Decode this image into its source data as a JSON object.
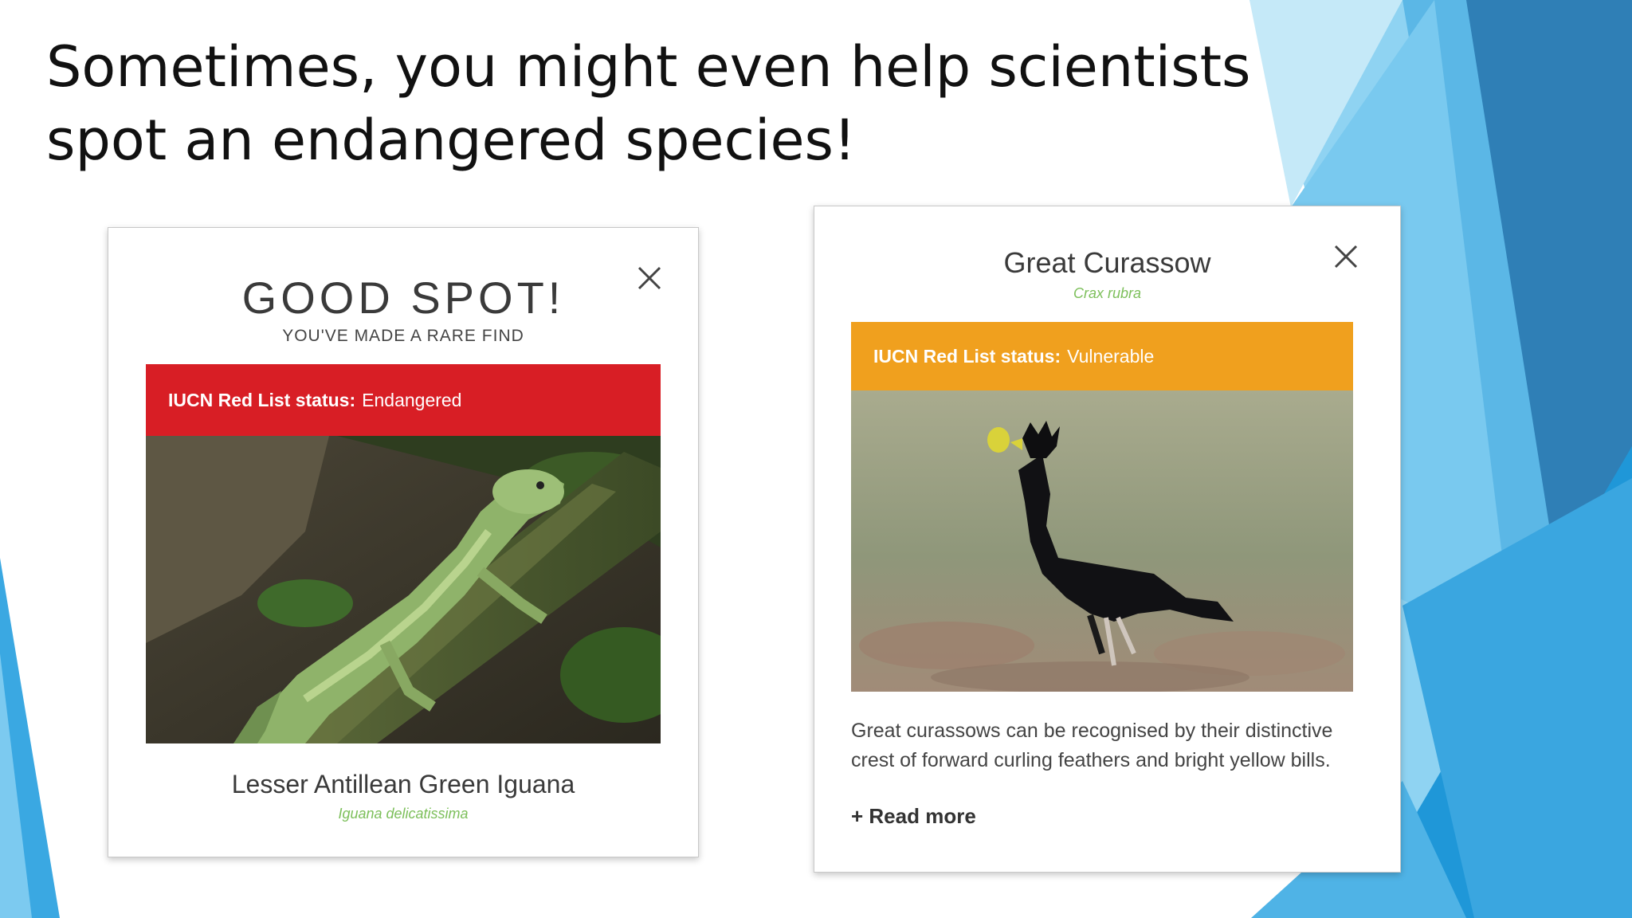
{
  "slide": {
    "title": "Sometimes, you might even help scientists spot an endangered species!"
  },
  "colors": {
    "endangered_red": "#d81e25",
    "vulnerable_orange": "#f0a01e",
    "scientific_name_green": "#7cbf5a",
    "accent_blue": "#2f9fd8"
  },
  "cards": [
    {
      "heading": "GOOD SPOT!",
      "subheading": "YOU'VE MADE A RARE FIND",
      "status_label": "IUCN Red List status:",
      "status_value": "Endangered",
      "photo_subject": "green iguana on a mossy branch",
      "common_name": "Lesser Antillean Green Iguana",
      "scientific_name": "Iguana delicatissima",
      "close_icon": "close-icon"
    },
    {
      "common_name": "Great Curassow",
      "scientific_name": "Crax rubra",
      "status_label": "IUCN Red List status:",
      "status_value": "Vulnerable",
      "photo_subject": "black curassow bird standing on grass",
      "description": "Great curassows can be recognised by their distinctive crest of forward curling feathers and bright yellow bills.",
      "read_more": "+ Read more",
      "close_icon": "close-icon"
    }
  ]
}
